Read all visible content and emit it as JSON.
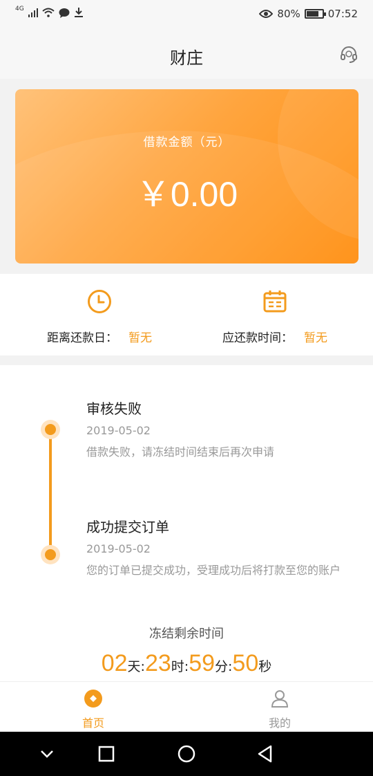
{
  "status": {
    "network": "4G",
    "battery": "80%",
    "battery_level": 0.8,
    "time": "07:52"
  },
  "header": {
    "title": "财庄",
    "service_icon": "headset-icon"
  },
  "loan_card": {
    "label": "借款金额（元）",
    "amount": "￥0.00"
  },
  "info": {
    "left": {
      "icon": "clock-icon",
      "label": "距离还款日：",
      "value": "暂无"
    },
    "right": {
      "icon": "calendar-icon",
      "label": "应还款时间：",
      "value": "暂无"
    }
  },
  "timeline": [
    {
      "title": "审核失败",
      "date": "2019-05-02",
      "desc": "借款失败，请冻结时间结束后再次申请"
    },
    {
      "title": "成功提交订单",
      "date": "2019-05-02",
      "desc": "您的订单已提交成功，受理成功后将打款至您的账户"
    }
  ],
  "countdown": {
    "label": "冻结剩余时间",
    "days": "02",
    "days_unit": "天:",
    "hours": "23",
    "hours_unit": "时:",
    "minutes": "59",
    "minutes_unit": "分:",
    "seconds": "50",
    "seconds_unit": "秒"
  },
  "tabs": [
    {
      "label": "首页",
      "icon": "home-coin-icon",
      "active": true
    },
    {
      "label": "我的",
      "icon": "person-icon",
      "active": false
    }
  ],
  "colors": {
    "accent": "#f39b1d",
    "card_start": "#ffc27a",
    "card_end": "#ff8c0a"
  }
}
